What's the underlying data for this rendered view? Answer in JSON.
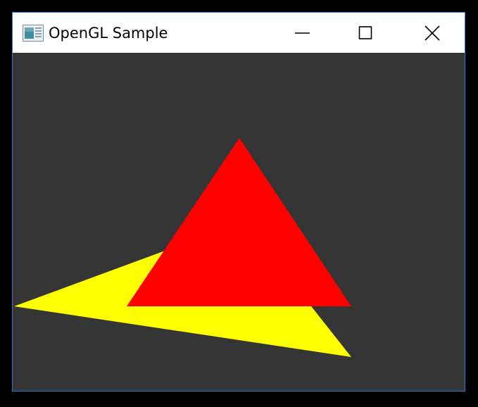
{
  "window": {
    "title": "OpenGL Sample",
    "app_icon": "window-app-icon",
    "controls": {
      "minimize_icon": "minimize-icon",
      "maximize_icon": "maximize-icon",
      "close_icon": "close-icon"
    }
  },
  "viewport": {
    "background_color": "#353535",
    "shapes": [
      {
        "name": "yellow-triangle",
        "color": "#ffff00"
      },
      {
        "name": "red-triangle",
        "color": "#ff0000"
      }
    ]
  },
  "colors": {
    "window_border": "#2b78d6",
    "titlebar": "#ffffff",
    "outer_background": "#000000"
  }
}
